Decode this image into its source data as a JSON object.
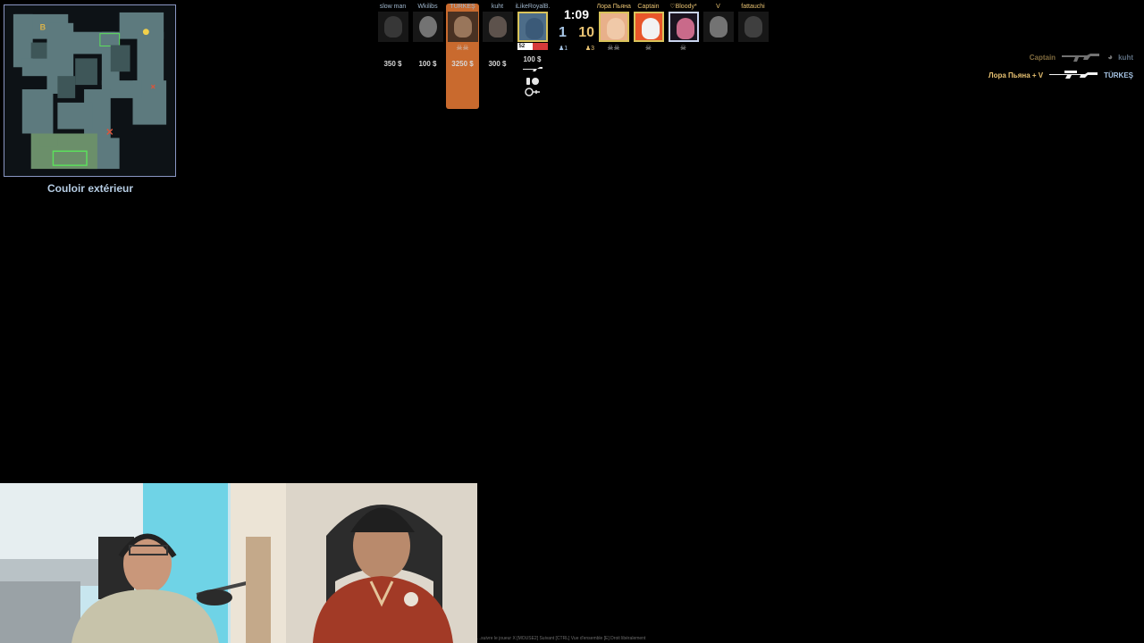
{
  "minimap": {
    "location_label": "Couloir extérieur",
    "site_label": "B"
  },
  "scoreboard": {
    "timer": "1:09",
    "score_ct": "1",
    "score_t": "10",
    "alive_ct": "♟1",
    "alive_t": "♟3",
    "ct_players": [
      {
        "name": "slow man",
        "money": "350 $",
        "alive": false,
        "stats": ""
      },
      {
        "name": "Wkilibs",
        "money": "100 $",
        "alive": false,
        "stats": ""
      },
      {
        "name": "TÜRKEŞ",
        "money": "3250 $",
        "alive": false,
        "stats": "☠☠",
        "highlight": true
      },
      {
        "name": "kuht",
        "money": "300 $",
        "alive": false,
        "stats": ""
      },
      {
        "name": "iLikeRoyalB..",
        "money": "100 $",
        "alive": true,
        "stats": "",
        "hp": "52",
        "hp_fraction": 0.52
      }
    ],
    "t_players": [
      {
        "name": "Лора Пьяна",
        "alive": true,
        "stats": "☠☠"
      },
      {
        "name": "Captain",
        "alive": true,
        "stats": "☠"
      },
      {
        "name": "♡Bloody*",
        "alive": true,
        "stats": "☠"
      },
      {
        "name": "V",
        "alive": false,
        "stats": ""
      },
      {
        "name": "fattauchi",
        "alive": false,
        "stats": ""
      }
    ]
  },
  "killfeed": [
    {
      "killer": "Captain",
      "victim": "kuht",
      "weapon_icon": "ak47-icon",
      "faded": true
    },
    {
      "killer": "Лора Пьяна + V",
      "victim": "TÜRKEŞ",
      "weapon_icon": "awp-icon",
      "faded": false
    }
  ],
  "hint_bar": "...suivre le joueur X   [MOUSE2] Suivant   [CTRL] Vue d'ensemble   [E] Droit libéralement",
  "colors": {
    "ct": "#a8c6e6",
    "t": "#e8c272",
    "highlight": "#c96a2e",
    "background": "#000000"
  }
}
